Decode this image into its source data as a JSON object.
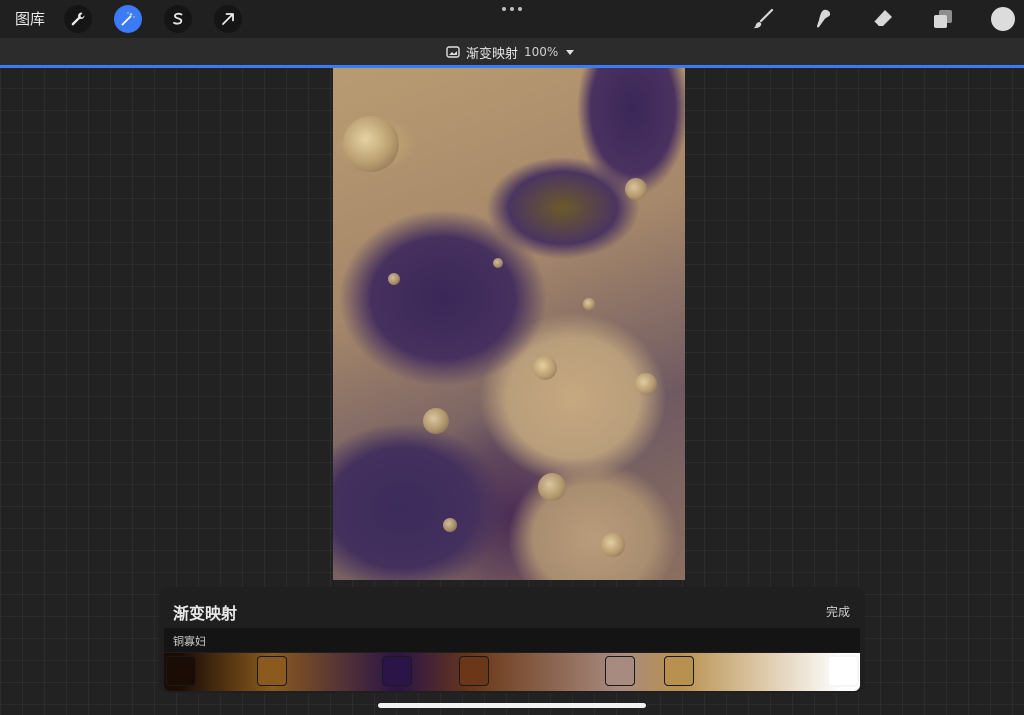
{
  "topbar": {
    "gallery_label": "图库",
    "tools_left": [
      {
        "name": "wrench-icon",
        "active": false
      },
      {
        "name": "magic-wand-icon",
        "active": true
      },
      {
        "name": "selection-s-icon",
        "active": false
      },
      {
        "name": "transform-arrow-icon",
        "active": false
      }
    ],
    "tools_right": [
      "brush-icon",
      "smudge-icon",
      "eraser-icon",
      "layers-icon"
    ],
    "current_color": "#dcdcdc"
  },
  "subbar": {
    "adjustment_title": "渐变映射",
    "percentage": "100%"
  },
  "panel": {
    "title": "渐变映射",
    "done_label": "完成",
    "preset_name": "铜寡妇",
    "gradient_stops": [
      {
        "color": "#1b0d05",
        "position": 0.025
      },
      {
        "color": "#8a5a1e",
        "position": 0.155
      },
      {
        "color": "#2a1448",
        "position": 0.335
      },
      {
        "color": "#6a3818",
        "position": 0.445
      },
      {
        "color": "#a88b80",
        "position": 0.655
      },
      {
        "color": "#b8904f",
        "position": 0.74
      },
      {
        "color": "#ffffff",
        "position": 0.975
      }
    ],
    "selected_stop": 6
  },
  "colors": {
    "accent": "#3b7bf5"
  }
}
